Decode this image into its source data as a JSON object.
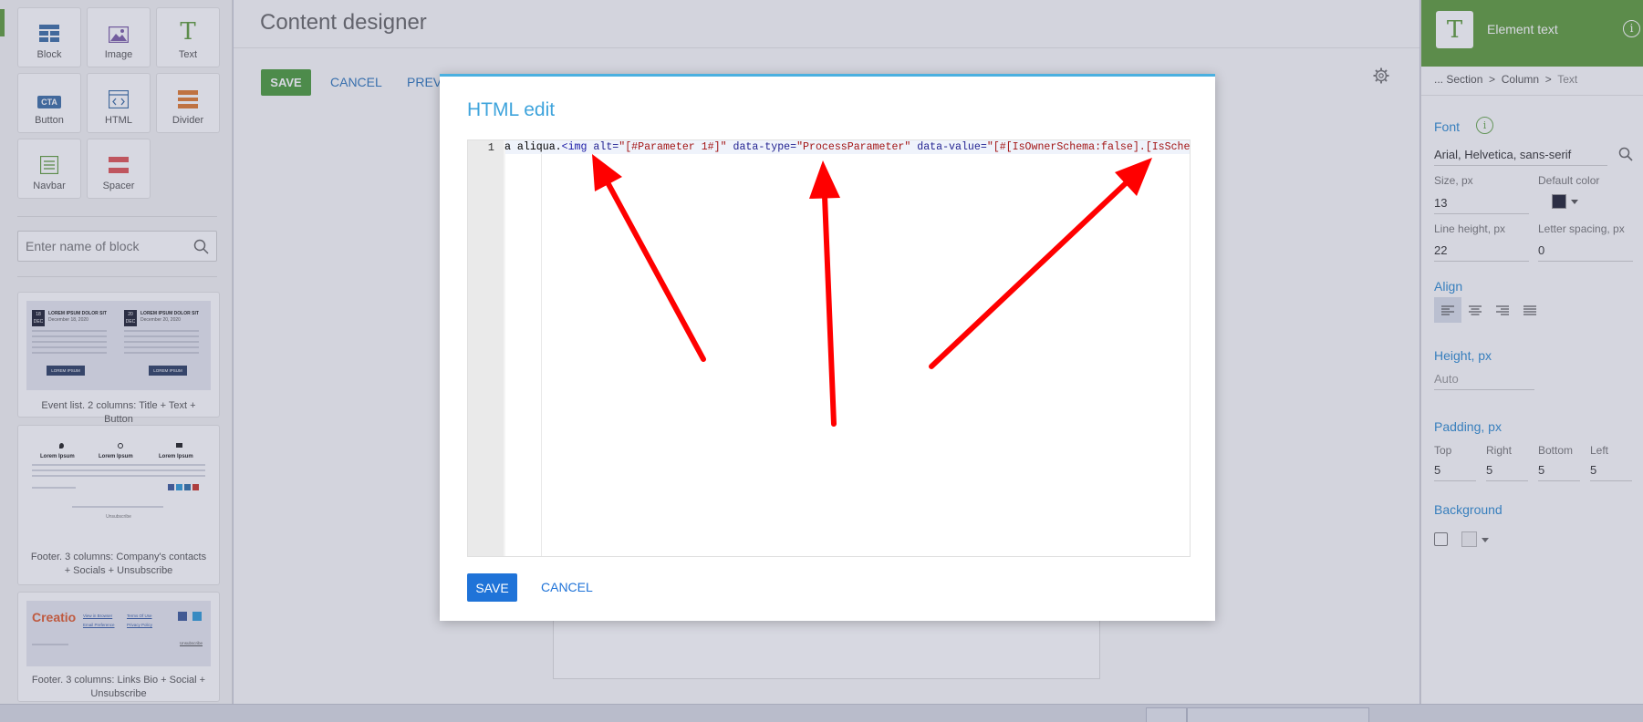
{
  "palette": {
    "tiles": [
      {
        "label": "Block",
        "icon": "block-icon"
      },
      {
        "label": "Image",
        "icon": "image-icon"
      },
      {
        "label": "Text",
        "icon": "text-icon"
      },
      {
        "label": "Button",
        "icon": "button-icon",
        "badge": "CTA"
      },
      {
        "label": "HTML",
        "icon": "html-icon"
      },
      {
        "label": "Divider",
        "icon": "divider-icon"
      },
      {
        "label": "Navbar",
        "icon": "navbar-icon"
      },
      {
        "label": "Spacer",
        "icon": "spacer-icon"
      }
    ],
    "search_placeholder": "Enter name of block",
    "templates": [
      {
        "caption": "Event list. 2 columns: Title + Text + Button",
        "preview": {
          "d1": "18",
          "m1": "DEC",
          "t1": "LOREM IPSUM DOLOR SIT",
          "s1": "December 18, 2020",
          "b1": "LOREM IPSUM",
          "d2": "20",
          "m2": "DEC",
          "t2": "LOREM IPSUM DOLOR SIT",
          "s2": "December 20, 2020",
          "b2": "LOREM IPSUM"
        }
      },
      {
        "caption": "Footer. 3 columns: Company's contacts + Socials + Unsubscribe",
        "preview": {
          "c1": "Lorem Ipsum",
          "c2": "Lorem Ipsum",
          "c3": "Lorem Ipsum",
          "unsub": "Unsubscribe"
        }
      },
      {
        "caption": "Footer. 3 columns: Links Bio + Social + Unsubscribe",
        "preview": {
          "logo": "Creatio",
          "l1": "View in Browser",
          "l2": "Terms Of Use",
          "l3": "Email Preference",
          "l4": "Privacy Policy",
          "unsub": "Unsubscribe"
        }
      }
    ]
  },
  "designer": {
    "title": "Content designer",
    "save": "SAVE",
    "cancel": "CANCEL",
    "preview": "PREVIEW"
  },
  "modal": {
    "title": "HTML edit",
    "line_number": "1",
    "code": {
      "t1": "a aliqua.",
      "t2": "<img",
      "t3": " alt=",
      "t4": "\"[#Parameter 1#]\"",
      "t5": " data-type=",
      "t6": "\"ProcessParameter\"",
      "t7": " data-value=",
      "t8": "\"[#[IsOwnerSchema:false].[IsSchema:fal"
    },
    "save": "SAVE",
    "cancel": "CANCEL"
  },
  "right_panel": {
    "title": "Element text",
    "breadcrumb": {
      "part1": "... Section",
      "part2": "Column",
      "part3": "Text",
      "sep": ">"
    },
    "font": {
      "section": "Font",
      "family": "Arial, Helvetica, sans-serif",
      "size_label": "Size, px",
      "size": "13",
      "default_color_label": "Default color",
      "default_color": "#1f2233",
      "line_height_label": "Line height, px",
      "line_height": "22",
      "letter_spacing_label": "Letter spacing, px",
      "letter_spacing": "0"
    },
    "align": {
      "section": "Align",
      "selected": "left"
    },
    "height": {
      "section": "Height, px",
      "placeholder": "Auto"
    },
    "padding": {
      "section": "Padding, px",
      "top_label": "Top",
      "top": "5",
      "right_label": "Right",
      "right": "5",
      "bottom_label": "Bottom",
      "bottom": "5",
      "left_label": "Left",
      "left": "5"
    },
    "background": {
      "section": "Background"
    }
  },
  "colors": {
    "green": "#5e9b3a",
    "blue_link": "#2e76bb",
    "modal_accent": "#3fa4dc",
    "modal_button": "#1f73d8",
    "annotation_arrow": "#ff0000"
  }
}
